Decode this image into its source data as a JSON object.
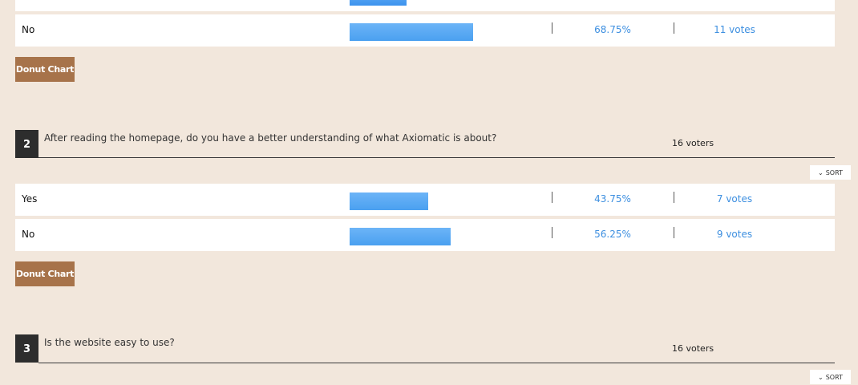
{
  "questions": [
    {
      "rows": [
        {
          "label": "No",
          "fraction": 0.6875,
          "pct": "68.75%",
          "votes": "11 votes"
        }
      ],
      "donut_label": "Donut Chart"
    },
    {
      "number": "2",
      "text": "After reading the homepage, do you have a better understanding of what Axiomatic is about?",
      "voters": "16 voters",
      "sort_label": "SORT",
      "rows": [
        {
          "label": "Yes",
          "fraction": 0.4375,
          "pct": "43.75%",
          "votes": "7 votes"
        },
        {
          "label": "No",
          "fraction": 0.5625,
          "pct": "56.25%",
          "votes": "9 votes"
        }
      ],
      "donut_label": "Donut Chart"
    },
    {
      "number": "3",
      "text": "Is the website easy to use?",
      "voters": "16 voters",
      "sort_label": "SORT"
    }
  ],
  "colors": {
    "bar": "#4aa0f0",
    "link": "#3d8fe0",
    "button": "#a7734a",
    "background": "#f2e7dc"
  },
  "icons": {
    "sort": "chevron-down-icon"
  }
}
